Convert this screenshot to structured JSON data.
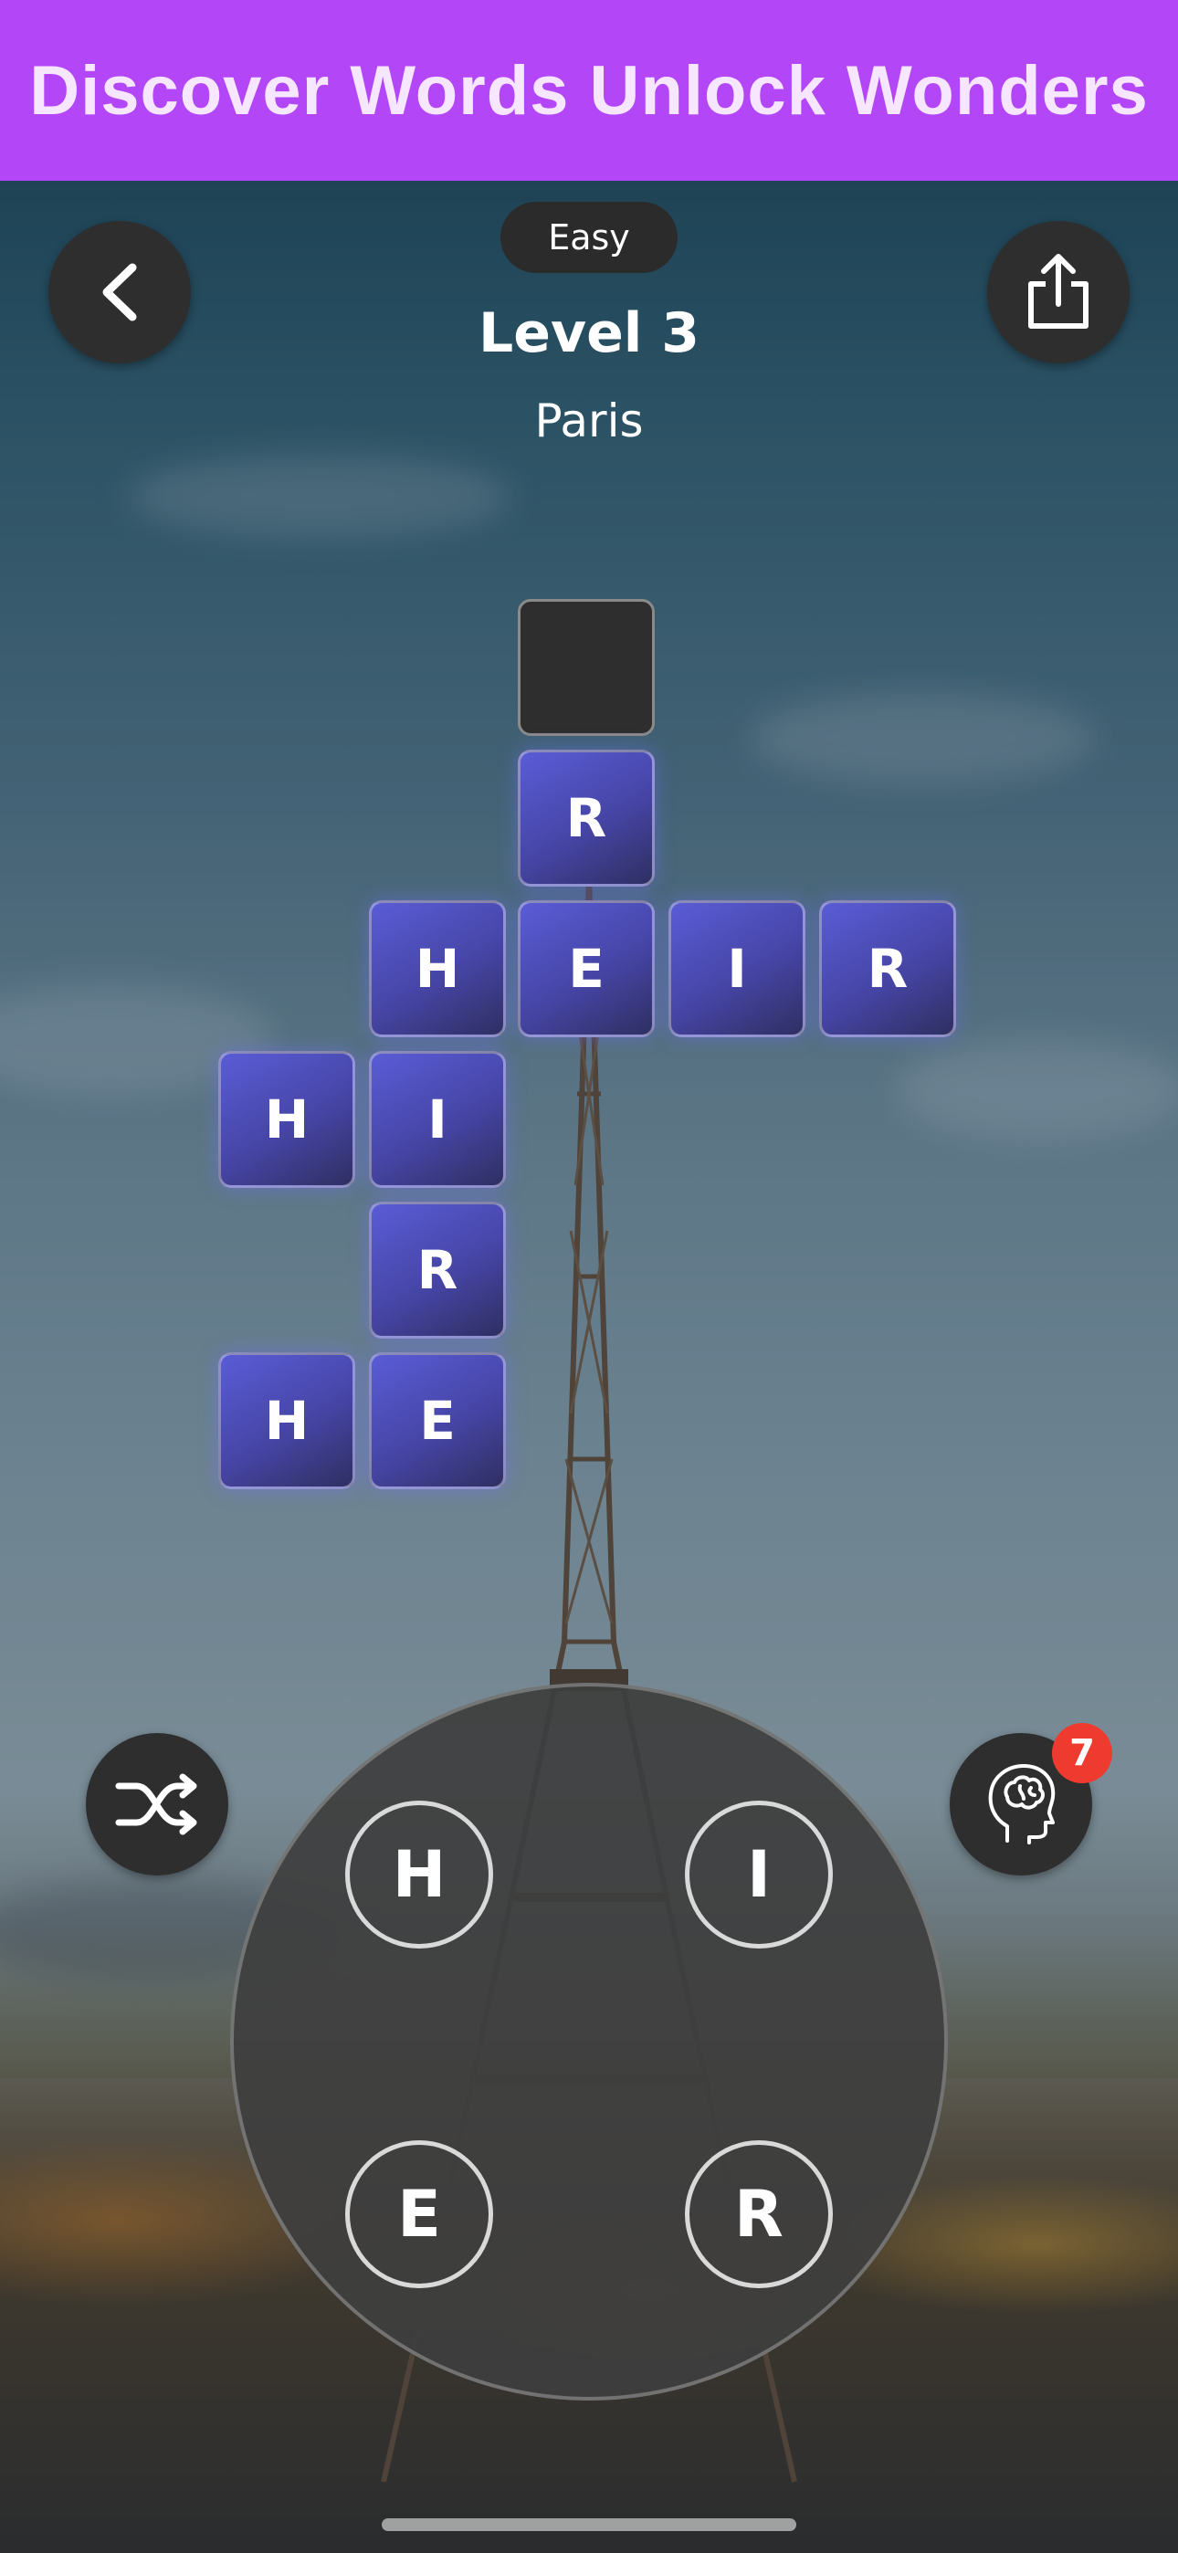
{
  "banner": {
    "text": "Discover Words Unlock Wonders",
    "color": "#b347f8"
  },
  "header": {
    "back_icon": "chevron-left-icon",
    "share_icon": "share-icon",
    "difficulty": "Easy",
    "level_title": "Level 3",
    "level_subtitle": "Paris"
  },
  "board": {
    "tile_color": "#4f50c4",
    "tiles": [
      {
        "letter": ""
      },
      {
        "letter": "R"
      },
      {
        "letter": "H"
      },
      {
        "letter": "E"
      },
      {
        "letter": "I"
      },
      {
        "letter": "R"
      },
      {
        "letter": "H"
      },
      {
        "letter": "I"
      },
      {
        "letter": "R"
      },
      {
        "letter": "H"
      },
      {
        "letter": "E"
      }
    ]
  },
  "controls": {
    "shuffle_icon": "shuffle-icon",
    "hint_icon": "brain-head-icon",
    "hint_count": "7",
    "badge_color": "#ef3b2f"
  },
  "wheel": {
    "letters": [
      "H",
      "I",
      "E",
      "R"
    ]
  }
}
